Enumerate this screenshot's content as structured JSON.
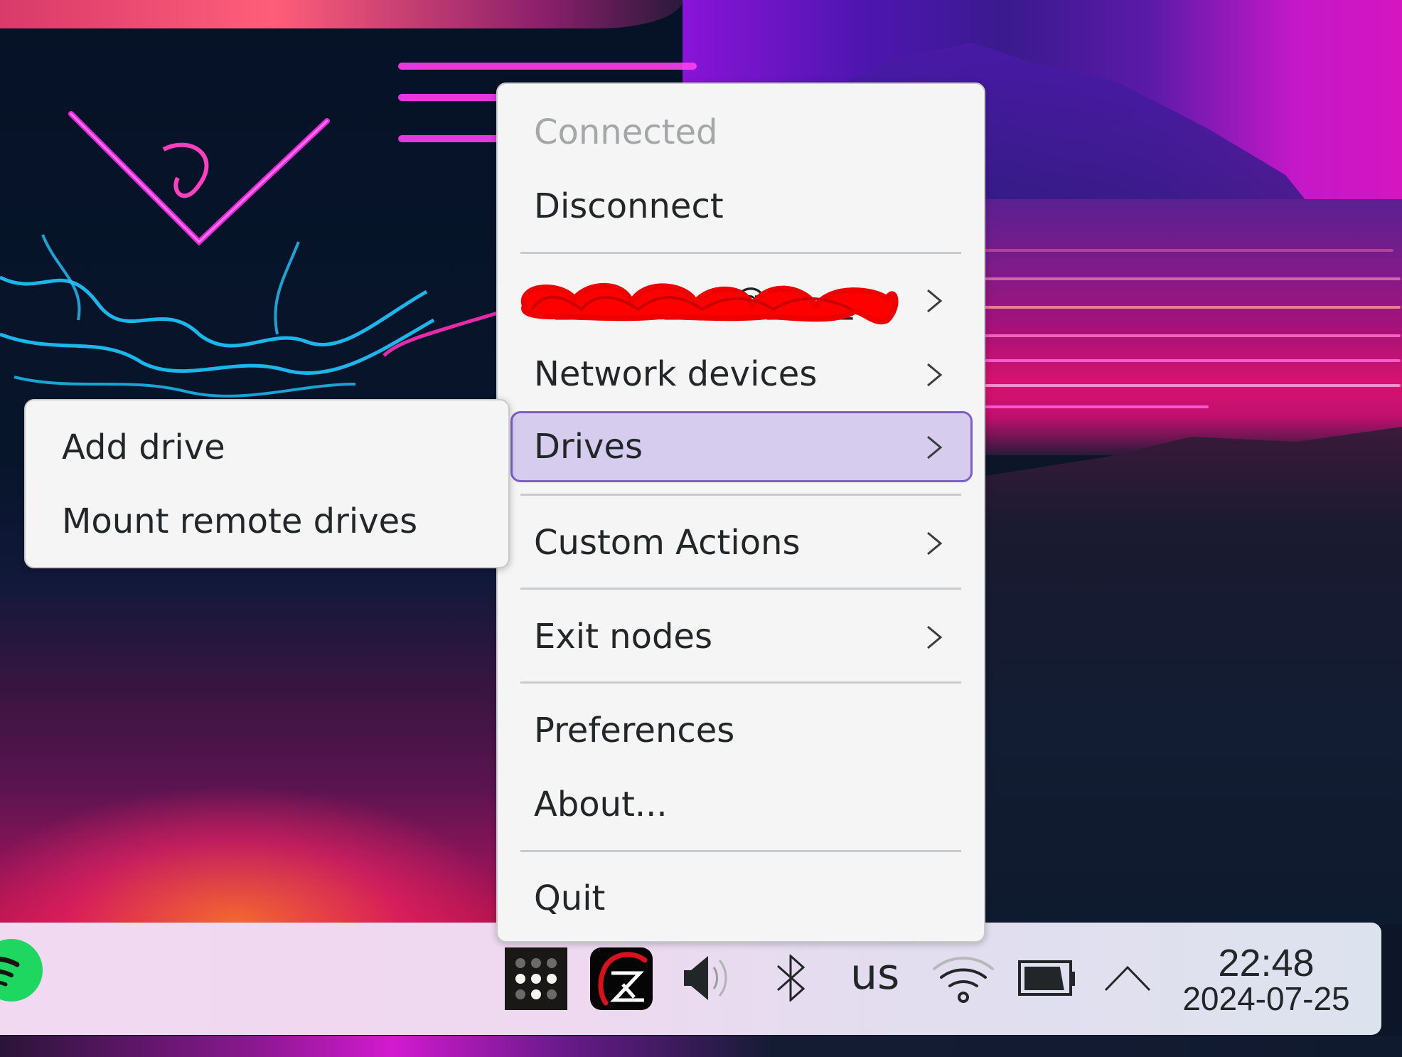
{
  "menu": {
    "status_label": "Connected",
    "items": [
      {
        "label": "Disconnect",
        "submenu": false
      },
      {
        "label": "[redacted account]",
        "submenu": true,
        "redacted": true
      },
      {
        "label": "Network devices",
        "submenu": true
      },
      {
        "label": "Drives",
        "submenu": true,
        "highlighted": true
      },
      {
        "label": "Custom Actions",
        "submenu": true
      },
      {
        "label": "Exit nodes",
        "submenu": true
      },
      {
        "label": "Preferences",
        "submenu": false
      },
      {
        "label": "About...",
        "submenu": false
      },
      {
        "label": "Quit",
        "submenu": false
      }
    ]
  },
  "drives_submenu": {
    "items": [
      {
        "label": "Add drive"
      },
      {
        "label": "Mount remote drives"
      }
    ]
  },
  "taskbar": {
    "apps": [
      {
        "icon": "spotify-icon"
      }
    ],
    "tray": [
      {
        "icon": "tailscale-icon"
      },
      {
        "icon": "app-red-gauge-icon"
      },
      {
        "icon": "volume-icon"
      },
      {
        "icon": "bluetooth-icon"
      },
      {
        "icon": "keyboard-layout-indicator",
        "text": "us"
      },
      {
        "icon": "wifi-icon",
        "signal_bars": 2,
        "signal_max": 3
      },
      {
        "icon": "battery-icon",
        "level_percent": 90
      },
      {
        "icon": "chevron-up-icon"
      }
    ],
    "clock": {
      "time": "22:48",
      "date": "2024-07-25"
    }
  },
  "colors": {
    "menu_bg": "#f4f5f4",
    "highlight_bg": "#d6cdee",
    "highlight_border": "#7e5fc9",
    "text": "#232629",
    "disabled_text": "#a4a6a8",
    "spotify_green": "#1ed760",
    "redaction": "#ff0000"
  }
}
